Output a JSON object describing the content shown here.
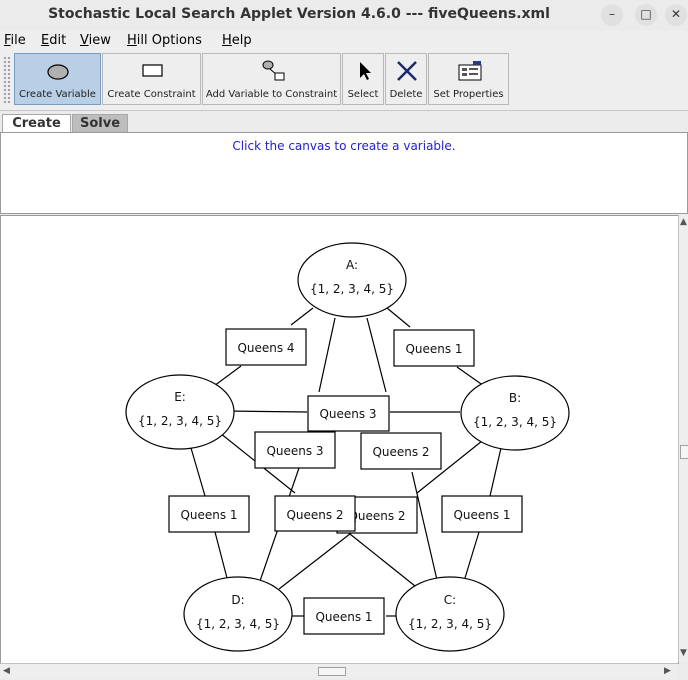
{
  "window": {
    "title": "Stochastic Local Search Applet Version 4.6.0 --- fiveQueens.xml",
    "minimize_glyph": "–",
    "maximize_glyph": "□",
    "close_glyph": "✕"
  },
  "menu": {
    "file": {
      "mnemonic": "F",
      "rest": "ile"
    },
    "edit": {
      "mnemonic": "E",
      "rest": "dit"
    },
    "view": {
      "mnemonic": "V",
      "rest": "iew"
    },
    "hill": {
      "mnemonic": "H",
      "rest": "ill Options"
    },
    "help": {
      "mnemonic": "H",
      "rest": "elp"
    }
  },
  "toolbar": {
    "create_variable": "Create Variable",
    "create_constraint": "Create Constraint",
    "add_variable_to_constraint": "Add Variable to Constraint",
    "select": "Select",
    "delete": "Delete",
    "set_properties": "Set Properties",
    "active_tool": "Create Variable"
  },
  "tabs": {
    "create": "Create",
    "solve": "Solve",
    "selected": "Create"
  },
  "message": "Click the canvas to create a variable.",
  "graph": {
    "variables": {
      "A": {
        "name": "A:",
        "domain": "{1, 2, 3, 4, 5}"
      },
      "B": {
        "name": "B:",
        "domain": "{1, 2, 3, 4, 5}"
      },
      "C": {
        "name": "C:",
        "domain": "{1, 2, 3, 4, 5}"
      },
      "D": {
        "name": "D:",
        "domain": "{1, 2, 3, 4, 5}"
      },
      "E": {
        "name": "E:",
        "domain": "{1, 2, 3, 4, 5}"
      }
    },
    "constraints": {
      "ab": "Queens 1",
      "ae": "Queens 4",
      "ac": "Queens 2",
      "ad": "Queens 3",
      "be": "Queens 3",
      "bd": "Queens 2",
      "bc": "Queens 1",
      "ec": "Queens 2",
      "ed": "Queens 1",
      "dc": "Queens 1"
    }
  },
  "colors": {
    "message_text": "#2222cc",
    "active_tool_bg": "#b8cfe5"
  }
}
